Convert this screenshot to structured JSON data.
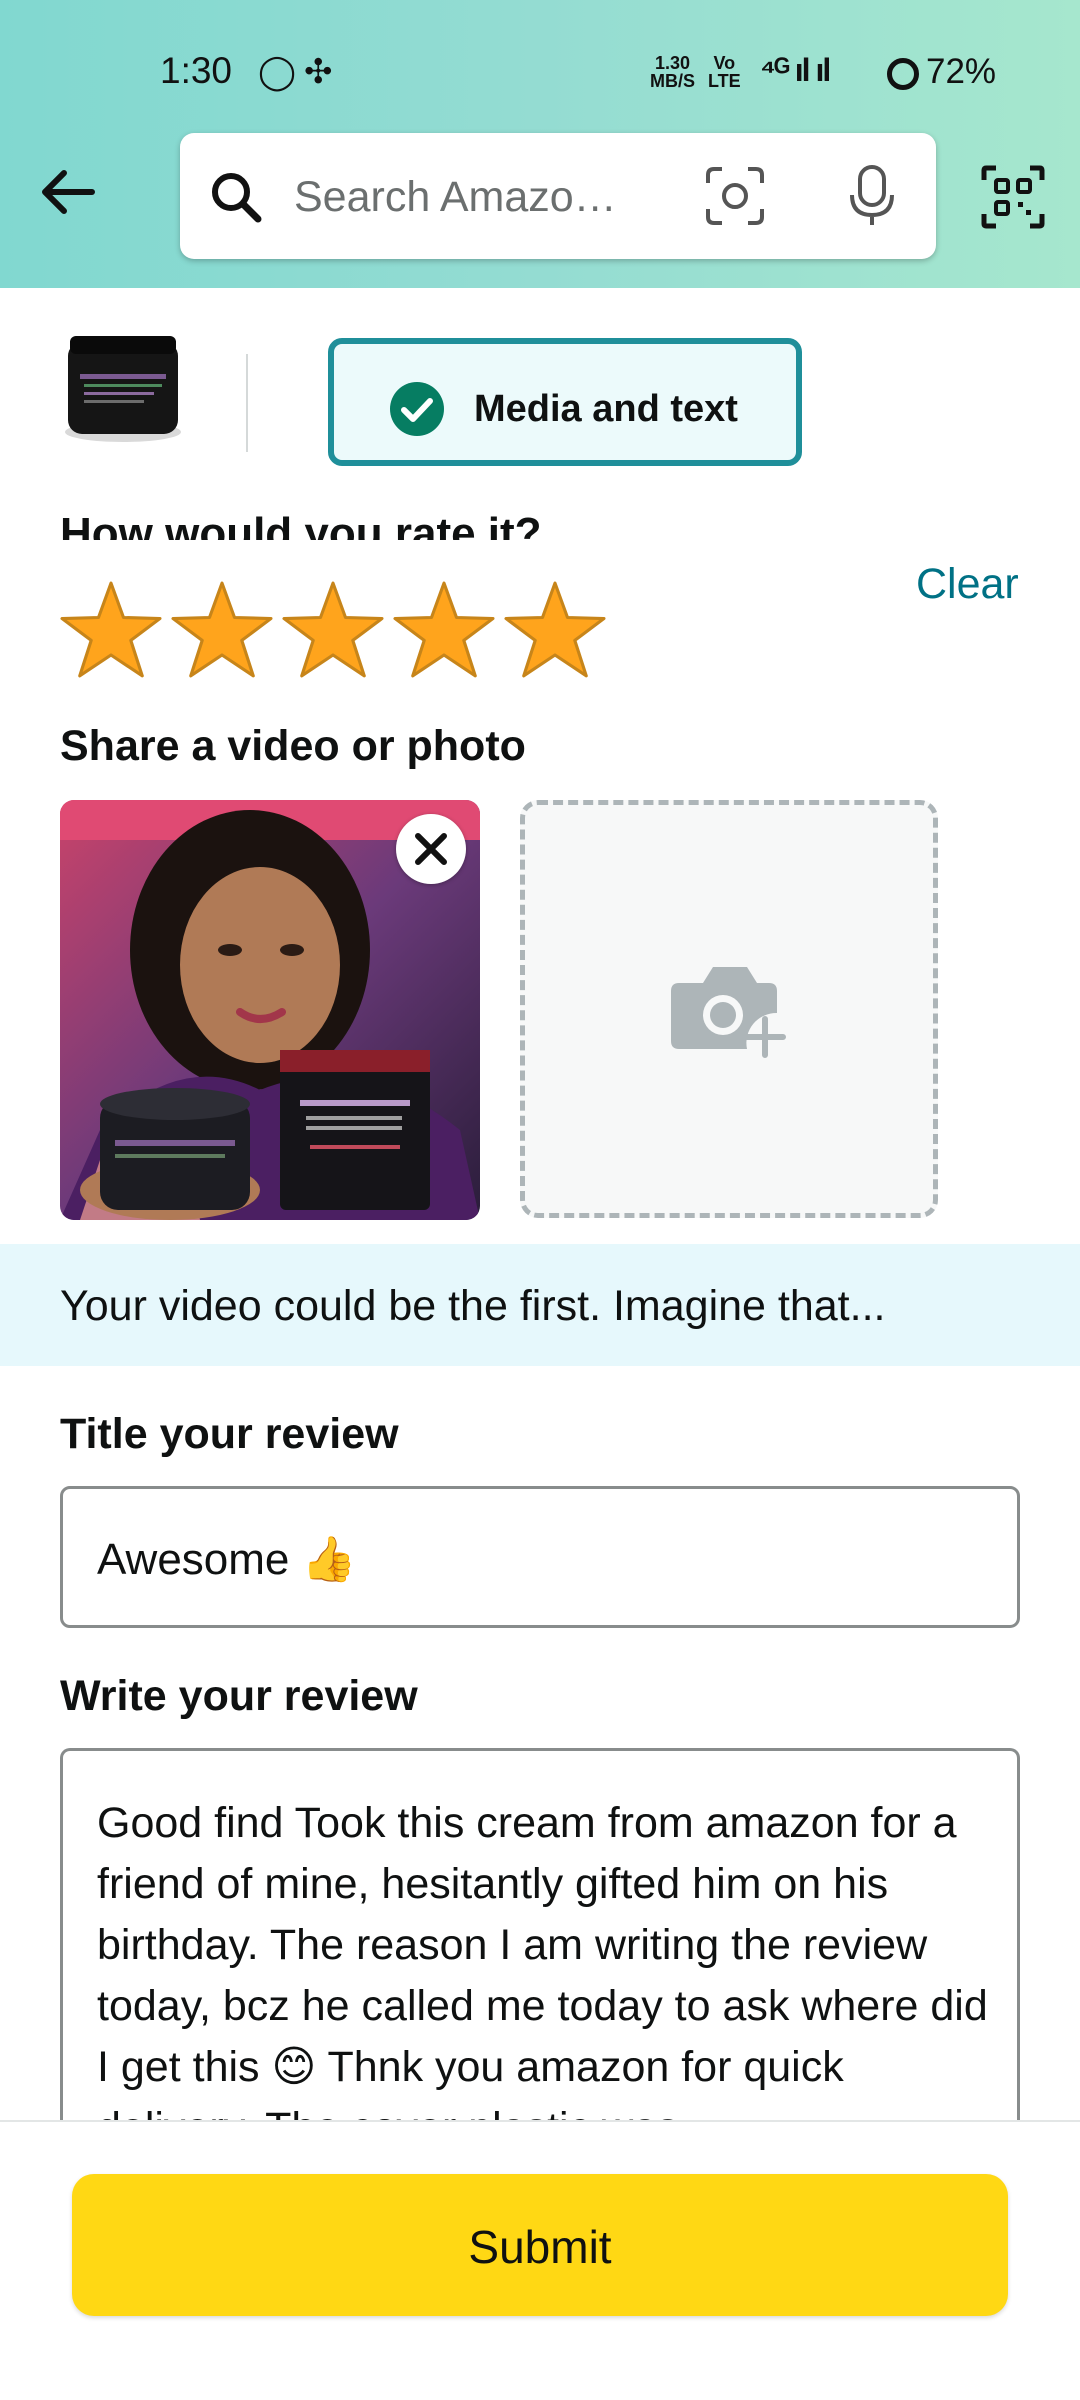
{
  "status_bar": {
    "time": "1:30",
    "app_icons": "◯✣",
    "net_speed_top": "1.30",
    "net_speed_bottom": "MB/S",
    "volte_top": "Vo",
    "volte_bottom": "LTE",
    "signal": "⁴ᴳ ıl ıl",
    "battery": "72%"
  },
  "header": {
    "search_placeholder": "Search Amazo…",
    "icons": [
      "back-arrow-icon",
      "search-icon",
      "camera-scan-icon",
      "mic-icon",
      "qr-scan-icon"
    ]
  },
  "product": {
    "chip_label": "Media and text"
  },
  "rating": {
    "heading": "How would you rate it?",
    "clear": "Clear",
    "stars": 5,
    "max_stars": 5,
    "star_color": "#ffa41c"
  },
  "media": {
    "heading": "Share a video or photo"
  },
  "banner": {
    "text": "Your video could be the first. Imagine that..."
  },
  "title_field": {
    "label": "Title your review",
    "value": "Awesome 👍"
  },
  "review_field": {
    "label": "Write your review",
    "value": "Good find Took this cream from amazon for a friend of mine, hesitantly gifted him on his birthday. The reason I am writing the review today, bcz he called me today to ask where did I get this 😊 Thnk you amazon for quick delivery. The cover plastic was"
  },
  "footer": {
    "submit": "Submit",
    "accent": "#ffd814"
  }
}
